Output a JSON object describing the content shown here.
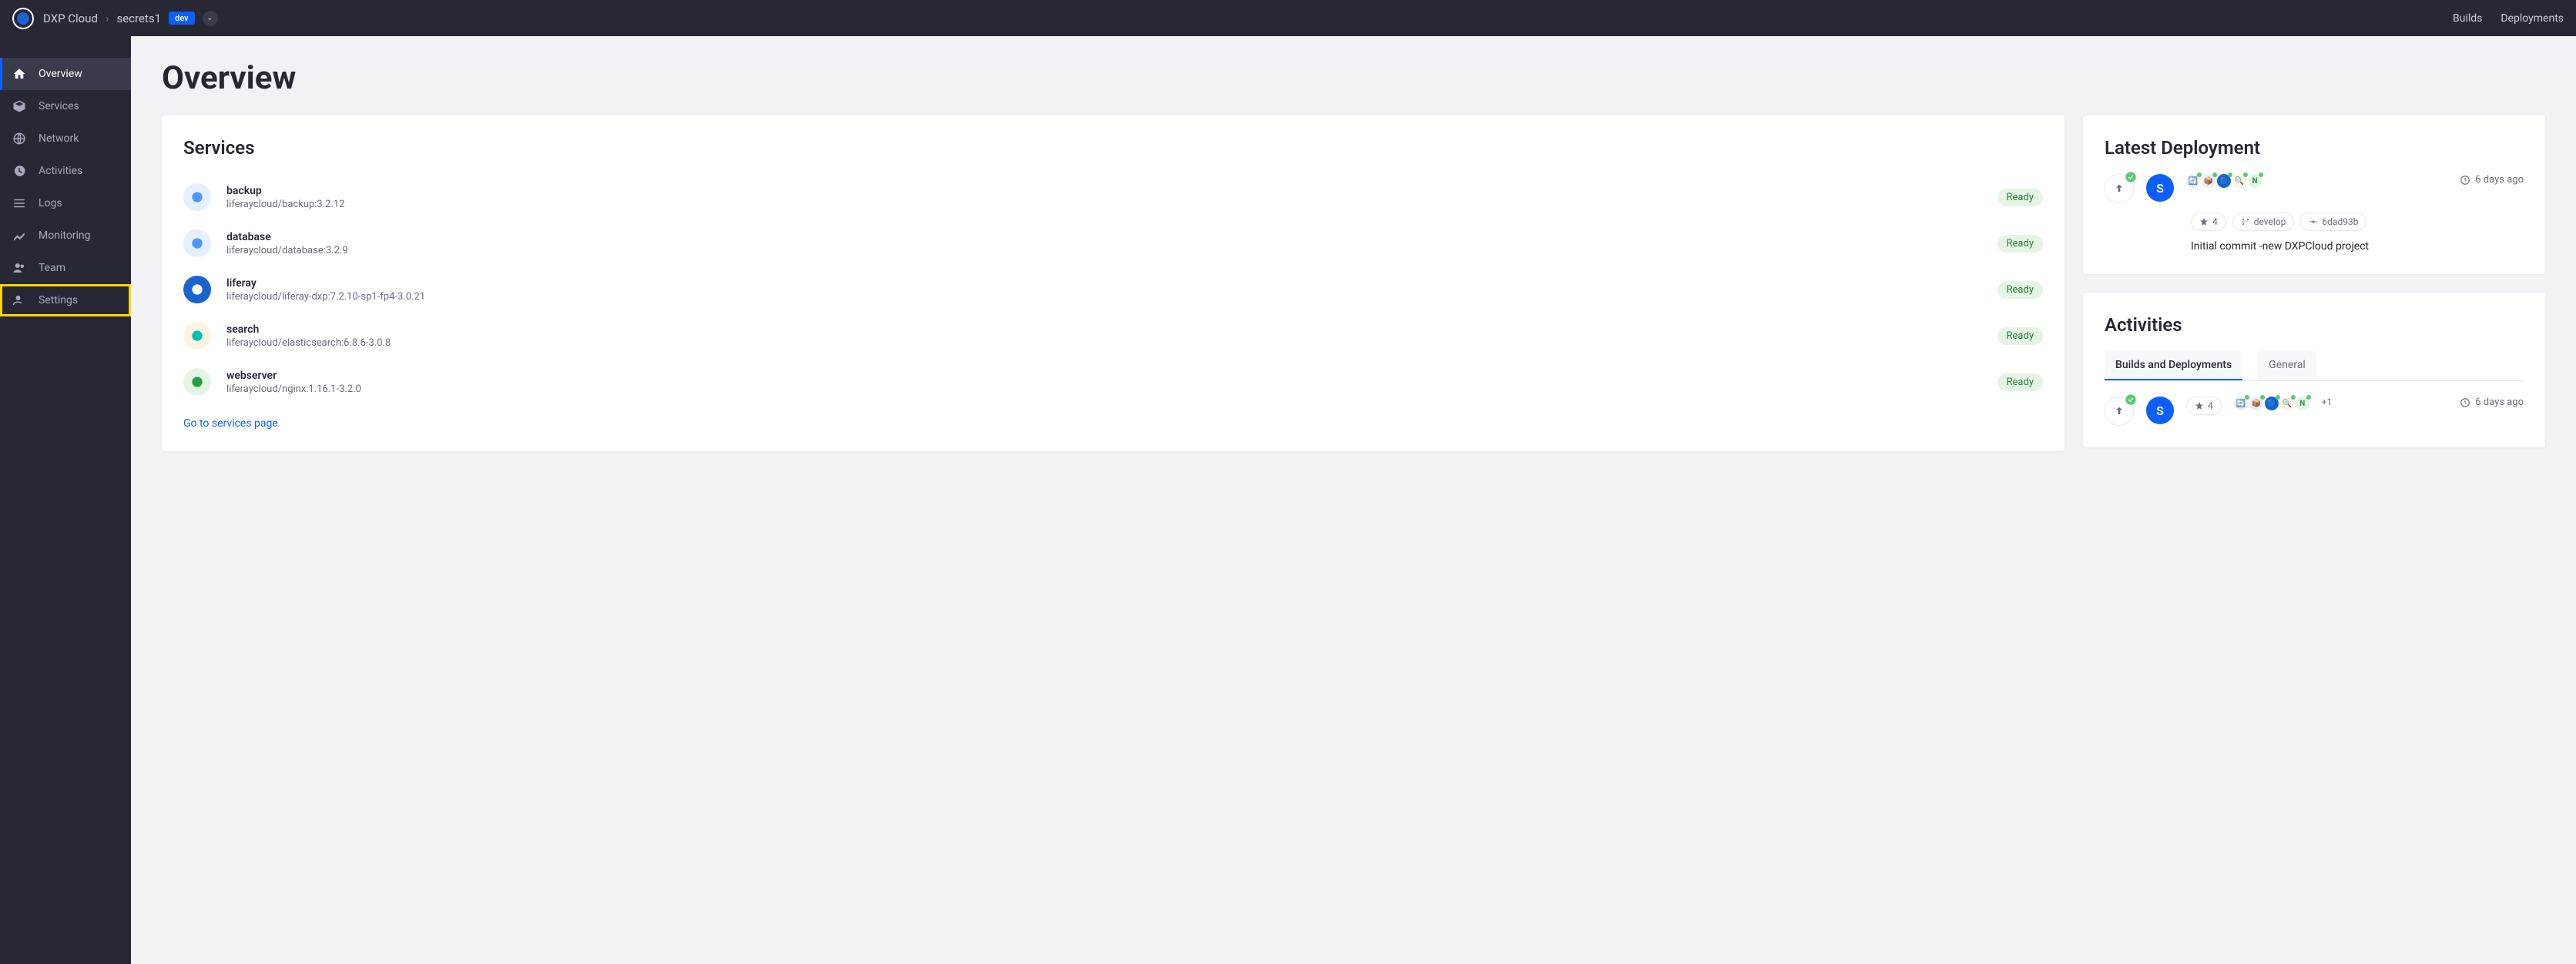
{
  "topbar": {
    "product": "DXP Cloud",
    "project": "secrets1",
    "env": "dev",
    "links": {
      "builds": "Builds",
      "deployments": "Deployments"
    }
  },
  "sidebar": {
    "items": [
      {
        "label": "Overview",
        "active": true
      },
      {
        "label": "Services"
      },
      {
        "label": "Network"
      },
      {
        "label": "Activities"
      },
      {
        "label": "Logs"
      },
      {
        "label": "Monitoring"
      },
      {
        "label": "Team"
      },
      {
        "label": "Settings",
        "highlighted": true
      }
    ]
  },
  "page": {
    "title": "Overview"
  },
  "services_card": {
    "title": "Services",
    "items": [
      {
        "name": "backup",
        "desc": "liferaycloud/backup:3.2.12",
        "status": "Ready",
        "icon_bg": "#e5f0ff",
        "icon_fg": "#4b9bff"
      },
      {
        "name": "database",
        "desc": "liferaycloud/database:3.2.9",
        "status": "Ready",
        "icon_bg": "#e5f0ff",
        "icon_fg": "#4b9bff"
      },
      {
        "name": "liferay",
        "desc": "liferaycloud/liferay-dxp:7.2.10-sp1-fp4-3.0.21",
        "status": "Ready",
        "icon_bg": "#1b63ce",
        "icon_fg": "#ffffff"
      },
      {
        "name": "search",
        "desc": "liferaycloud/elasticsearch:6.8.6-3.0.8",
        "status": "Ready",
        "icon_bg": "#fef3e0",
        "icon_fg": "#00bfb3"
      },
      {
        "name": "webserver",
        "desc": "liferaycloud/nginx:1.16.1-3.2.0",
        "status": "Ready",
        "icon_bg": "#e4f5e4",
        "icon_fg": "#269f42"
      }
    ],
    "link": "Go to services page"
  },
  "deployment_card": {
    "title": "Latest Deployment",
    "avatar": "S",
    "pills": {
      "count": "4",
      "branch": "develop",
      "commit": "6dad93b"
    },
    "message": "Initial commit -new DXPCloud project",
    "time": "6 days ago"
  },
  "activities_card": {
    "title": "Activities",
    "tabs": [
      {
        "label": "Builds and Deployments",
        "active": true
      },
      {
        "label": "General"
      }
    ],
    "row": {
      "avatar": "S",
      "count": "4",
      "plus": "+1",
      "time": "6 days ago"
    }
  }
}
